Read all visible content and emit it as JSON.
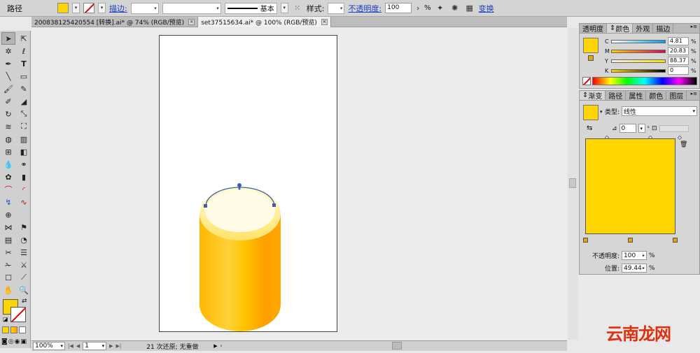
{
  "control_bar": {
    "object_type": "路径",
    "stroke_link": "描边:",
    "stroke_profile": "基本",
    "style_label": "样式:",
    "opacity_link": "不透明度:",
    "opacity_value": "100",
    "opacity_unit": "%",
    "transform_link": "变换",
    "fill_color": "#ffd500"
  },
  "tabs": [
    {
      "label": "200838125420554  [转换].ai* @ 74% (RGB/预览)"
    },
    {
      "label": "set37515634.ai* @ 100% (RGB/预览)"
    }
  ],
  "color_panel": {
    "tabs": [
      "透明度",
      "颜色",
      "外观",
      "描边"
    ],
    "channels": [
      {
        "name": "C",
        "value": "4.81",
        "unit": "%"
      },
      {
        "name": "M",
        "value": "20.83",
        "unit": "%"
      },
      {
        "name": "Y",
        "value": "88.37",
        "unit": "%"
      },
      {
        "name": "K",
        "value": "0",
        "unit": "%"
      }
    ]
  },
  "gradient_panel": {
    "tabs": [
      "渐变",
      "路径",
      "属性",
      "颜色",
      "图层"
    ],
    "type_label": "类型:",
    "type_value": "线性",
    "angle_value": "0",
    "opacity_label": "不透明度:",
    "opacity_value": "100",
    "location_label": "位置:",
    "location_value": "49.44",
    "unit": "%"
  },
  "status_bar": {
    "zoom": "100%",
    "artboard": "1",
    "undo_text": "21 次还原; 无重做"
  },
  "watermark": "云南龙网"
}
